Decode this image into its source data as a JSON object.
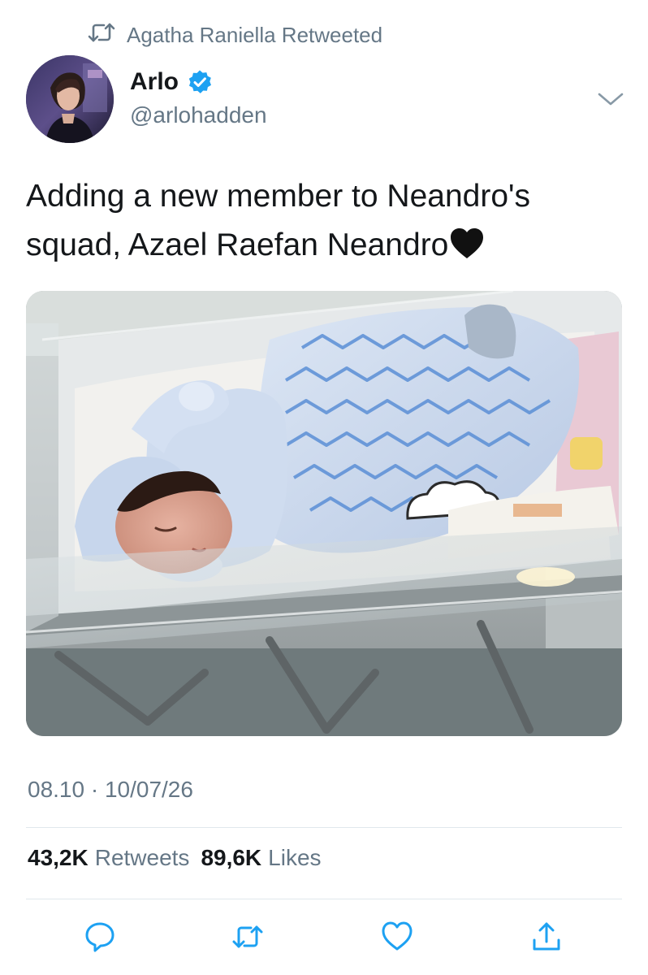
{
  "retweet_context": {
    "text": "Agatha Raniella Retweeted",
    "icon": "retweet-icon"
  },
  "author": {
    "name": "Arlo",
    "handle": "@arlohadden",
    "verified": true,
    "avatar": "avatar-photo"
  },
  "tweet": {
    "text": "Adding a new member to Neandro's squad, Azael Raefan Neandro",
    "emoji": "black-heart-emoji",
    "media": "photo-newborn-in-hospital-bassinet",
    "timestamp": "08.10 · 10/07/26"
  },
  "stats": {
    "retweets_count": "43,2K",
    "retweets_label": "Retweets",
    "likes_count": "89,6K",
    "likes_label": "Likes"
  },
  "actions": [
    {
      "name": "reply",
      "icon": "reply-icon"
    },
    {
      "name": "retweet",
      "icon": "retweet-icon"
    },
    {
      "name": "like",
      "icon": "heart-icon"
    },
    {
      "name": "share",
      "icon": "share-icon"
    }
  ],
  "colors": {
    "text_primary": "#14171a",
    "text_secondary": "#657786",
    "verified_blue": "#1da1f2",
    "divider": "#e1e8ed"
  }
}
